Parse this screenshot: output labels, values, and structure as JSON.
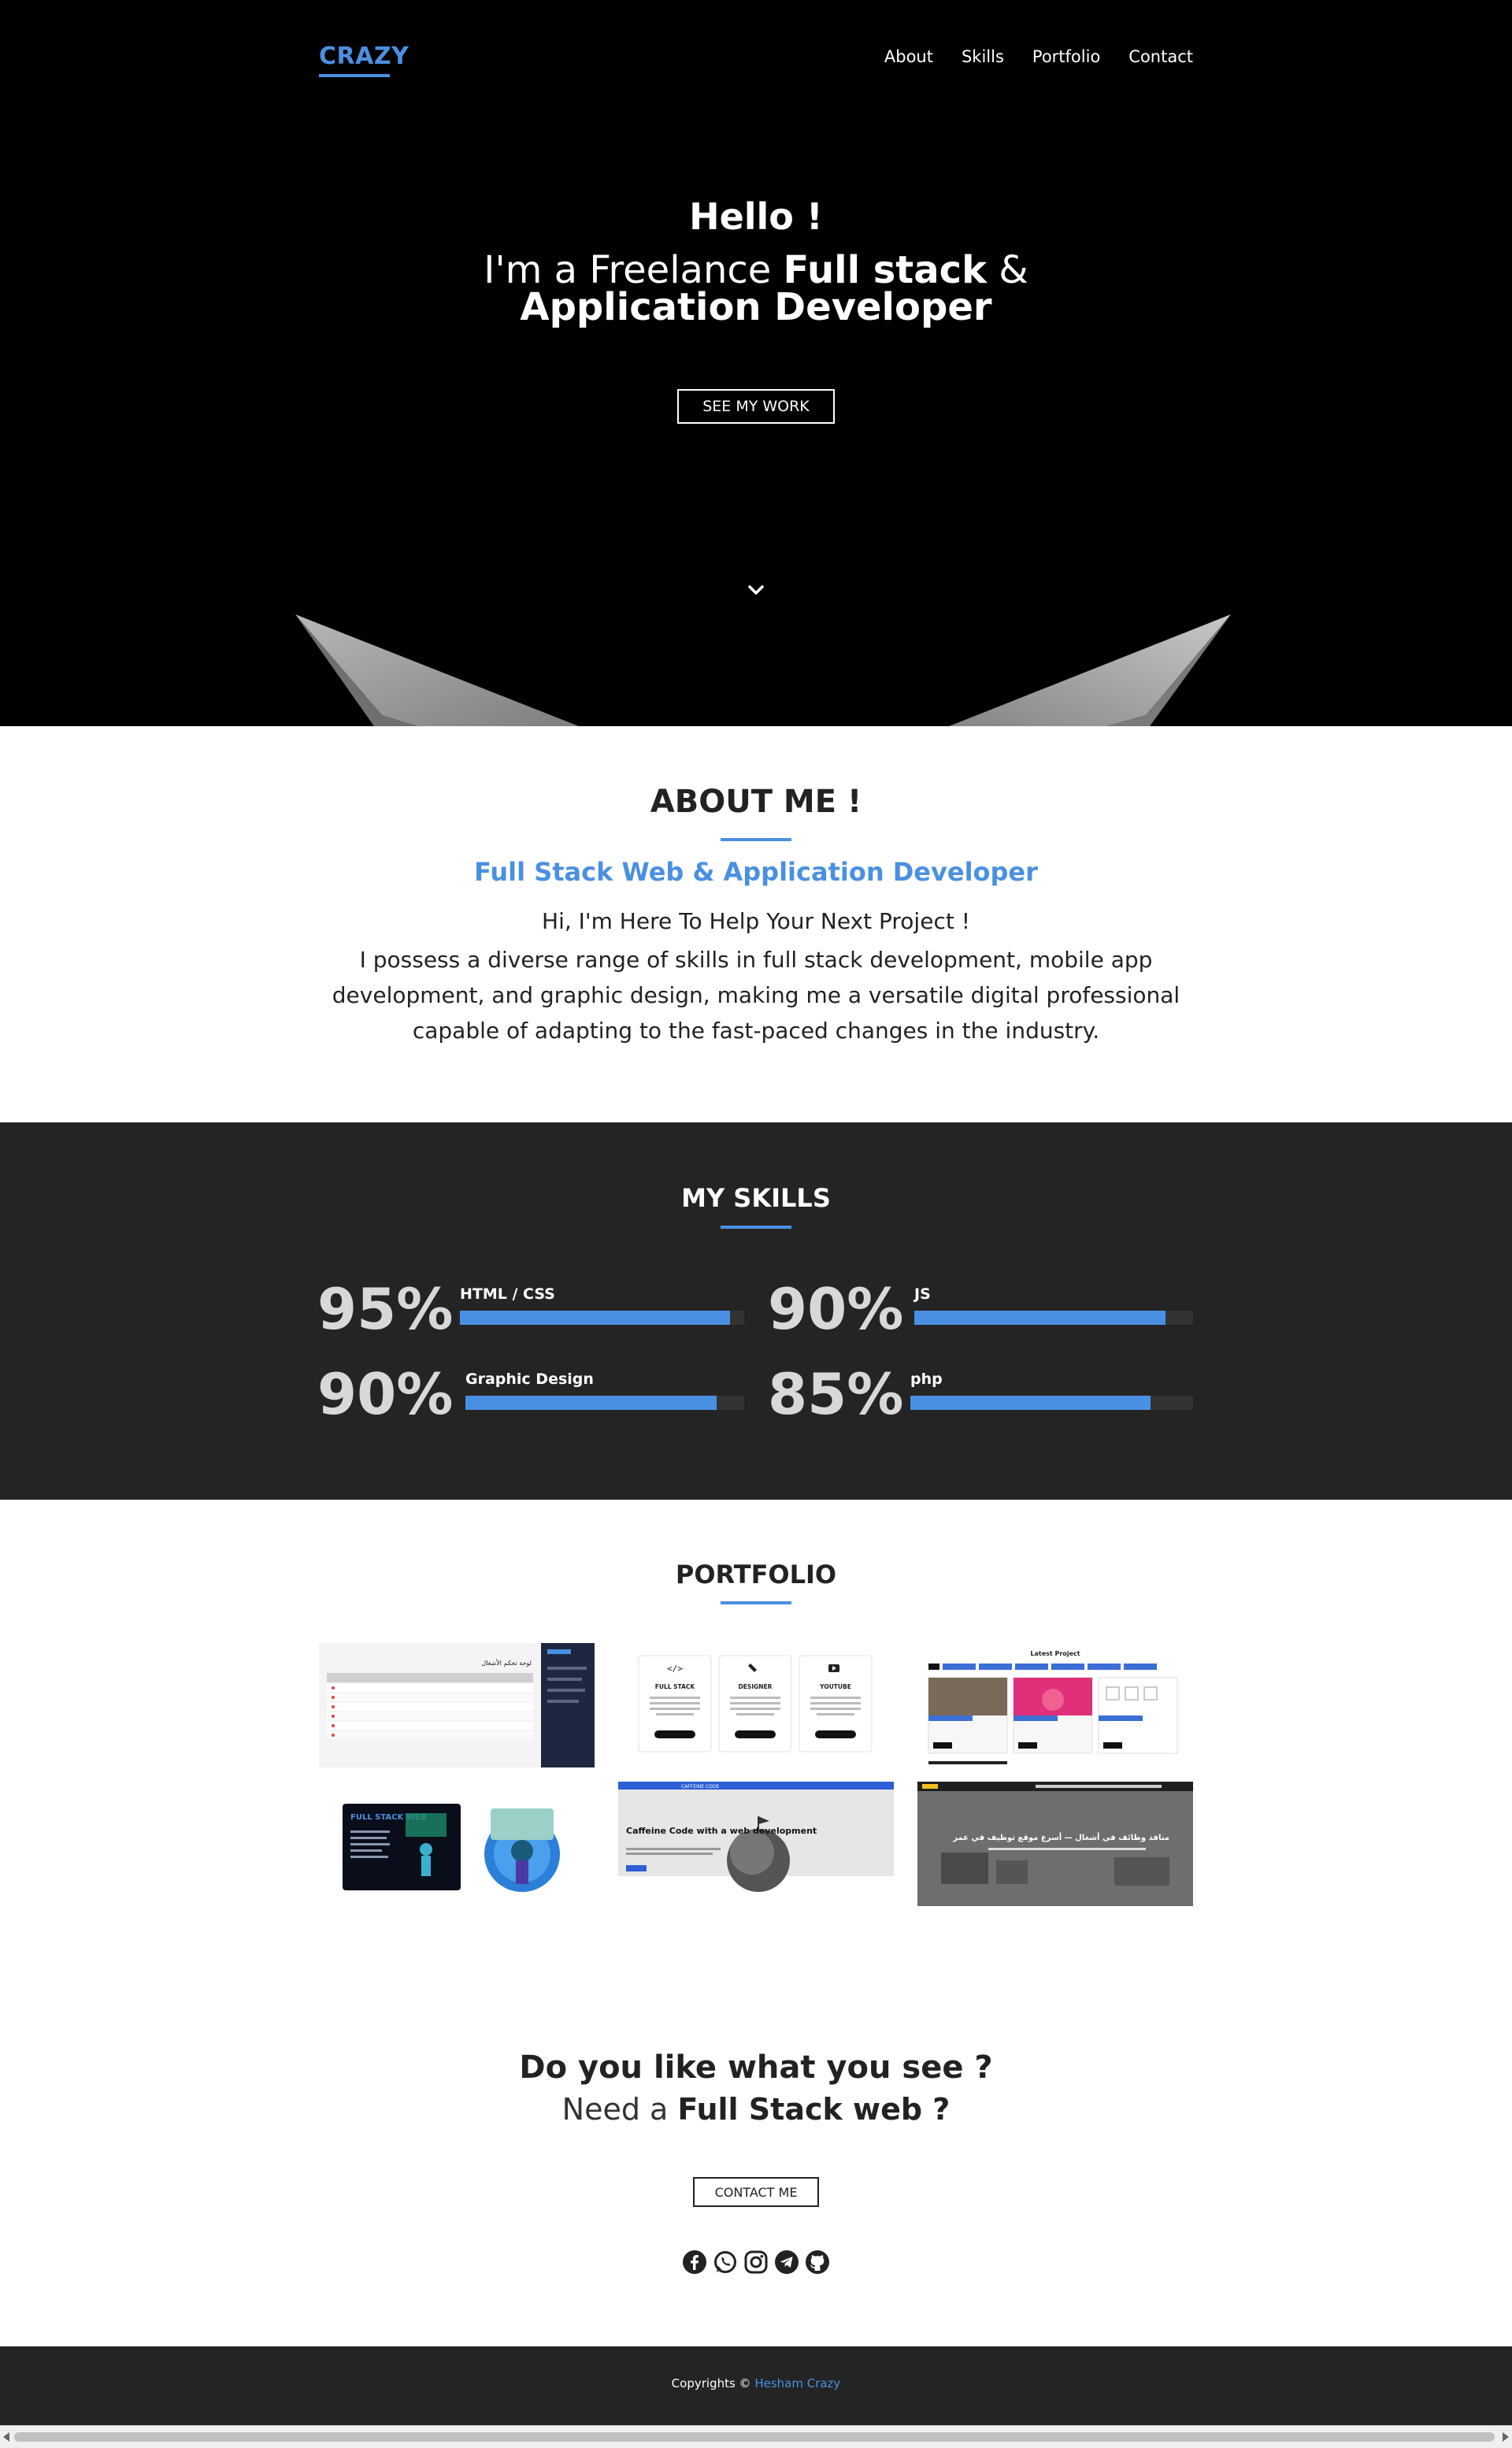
{
  "nav": {
    "logo": "CRAZY",
    "links": [
      "About",
      "Skills",
      "Portfolio",
      "Contact"
    ]
  },
  "hero": {
    "hello": "Hello !",
    "line1_prefix": "I'm a Freelance ",
    "line1_bold": "Full stack",
    "line1_suffix": " &",
    "line2": "Application Developer",
    "button": "SEE MY WORK",
    "scroll_icon": "chevron-down-icon"
  },
  "about": {
    "title": "ABOUT ME !",
    "subtitle": "Full Stack Web & Application Developer",
    "intro": "Hi, I'm Here To Help Your Next Project !",
    "text": "I possess a diverse range of skills in full stack development, mobile app development, and graphic design, making me a versatile digital professional capable of adapting to the fast-paced changes in the industry."
  },
  "skills": {
    "title": "MY SKILLS",
    "items": [
      {
        "percent": "95%",
        "name": "HTML / CSS",
        "level": 0.95
      },
      {
        "percent": "90%",
        "name": "JS",
        "level": 0.9
      },
      {
        "percent": "90%",
        "name": "Graphic Design",
        "level": 0.9
      },
      {
        "percent": "85%",
        "name": "php",
        "level": 0.85
      }
    ]
  },
  "portfolio": {
    "title": "PORTFOLIO",
    "projects": [
      {
        "title": "لوحة تحكم الأشغال"
      },
      {
        "cards": [
          "FULL STACK",
          "DESIGNER",
          "YOUTUBE"
        ]
      },
      {
        "title": "Latest Project"
      },
      {
        "title": "FULL STACK WEB"
      },
      {
        "title": "Caffeine Code with a web development",
        "brand": "CAFFEINE CODE"
      },
      {
        "title": "منافذ وظائف في أشغال — أسرع موقع توظيف في عمر"
      }
    ]
  },
  "cta": {
    "question": "Do you like what you see ?",
    "line2_prefix": "Need a ",
    "line2_bold": "Full Stack web ?",
    "button": "CONTACT ME",
    "socials": [
      "facebook-icon",
      "whatsapp-icon",
      "instagram-icon",
      "telegram-icon",
      "github-icon"
    ]
  },
  "footer": {
    "copyright": "Copyrights © ",
    "author": "Hesham Crazy"
  },
  "colors": {
    "accent": "#4a90e2",
    "dark": "#242424",
    "hero_bg": "#000000"
  }
}
